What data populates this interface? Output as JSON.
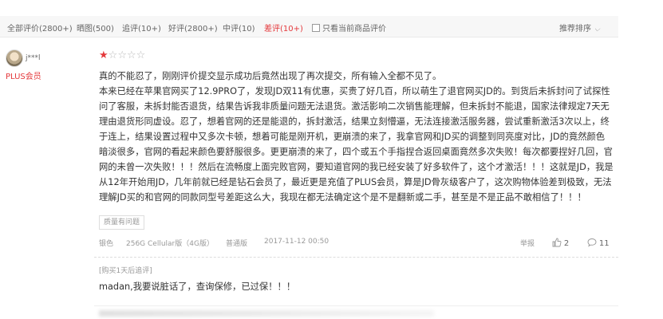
{
  "filters": {
    "all": "全部评价(2800+)",
    "photos": "晒图(500)",
    "followup": "追评(10+)",
    "positive": "好评(2800+)",
    "neutral": "中评(10)",
    "negative": "差评(10+)",
    "current_only": "只看当前商品评价",
    "sort": "推荐排序"
  },
  "review": {
    "user": "j***l",
    "badge": "PLUS会员",
    "rating": 1,
    "rating_max": 5,
    "paragraphs": [
      "真的不能忍了，刚刚评价提交显示成功后竟然出现了再次提交，所有输入全都不见了。",
      "本来已经在苹果官网买了12.9PRO了，发现JD双11有优惠，买贵了好几百，所以萌生了退官网买JD的。到货后未拆封问了试探性问了客服，未拆封能否退货，结果告诉我非质量问题无法退货。激活影响二次销售能理解，但未拆封不能退，国家法律规定7天无理由退货形同虚设。忍了，想着官网的还是能退的，拆封激活，结果立刻懵逼，无法连接激活服务器，尝试重新激活3次以上，终于连上，结果设置过程中又多次卡顿，想着可能是刚开机，更崩溃的来了，我拿官网和JD买的调整到同亮度对比，JD的竟然颜色暗淡很多，官网的看起来颜色要舒服很多。更更崩溃的来了，四个或五个手指捏合返回桌面竟然多次失败！每次都要捏好几回，官网的未曾一次失败！！！然后在流畅度上面完败官网，要知道官网的我已经安装了好多软件了，这个才激活！！！这就是JD，我是从12年开始用JD，几年前就已经是钻石会员了，最近更是充值了PLUS会员，算是JD骨灰级客户了，这次购物体验差到极致，无法理解JD买的和官网的同款同型号差距这么大，我现在都无法确定这个是不是翻新或二手，甚至是不是正品不敢相信了！！！"
    ],
    "tag": "质量有问题",
    "color": "银色",
    "spec": "256G Cellular版（4G版）",
    "edition": "普通版",
    "datetime": "2017-11-12 00:50",
    "report": "举报",
    "likes": "2",
    "comments": "11",
    "after_label": "[购买1天后追评]",
    "after_text": "madan,我要说脏话了，查询保修，已过保！！！"
  },
  "colors": {
    "accent": "#e4393c"
  },
  "icons": [
    "checkbox-icon",
    "chevron-down-icon",
    "star-icon",
    "thumbs-up-icon",
    "comment-icon"
  ]
}
